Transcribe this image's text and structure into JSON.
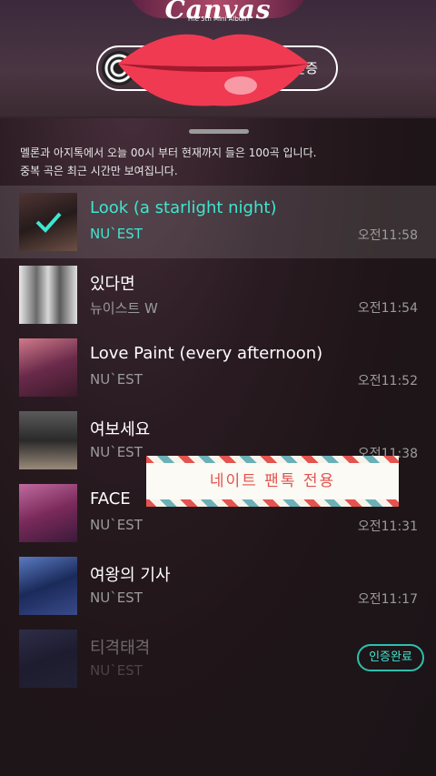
{
  "hero": {
    "album_title": "Canvas",
    "album_subtitle": "The 5th Mini Album",
    "auth_pill_label": "인증"
  },
  "notice": {
    "line1": "멜론과 아지톡에서 오늘 00시 부터 현재까지 들은 100곡 입니다.",
    "line2": "중복 곡은 최근 시간만 보여집니다."
  },
  "songs": [
    {
      "title": "Look (a starlight night)",
      "artist": "NU`EST",
      "time": "오전11:58",
      "state": "selected",
      "art_colors": [
        "#5a3a3a",
        "#a87a6a"
      ]
    },
    {
      "title": "있다면",
      "artist": "뉴이스트 W",
      "time": "오전11:54",
      "state": "normal",
      "art_colors": [
        "#d8d8d8",
        "#8a8a8a"
      ]
    },
    {
      "title": "Love Paint (every afternoon)",
      "artist": "NU`EST",
      "time": "오전11:52",
      "state": "normal",
      "art_colors": [
        "#6a2a4a",
        "#d07a8a"
      ]
    },
    {
      "title": "여보세요",
      "artist": "NU`EST",
      "time": "오전11:38",
      "state": "normal",
      "art_colors": [
        "#3a3a3a",
        "#9a8a7a"
      ]
    },
    {
      "title": "FACE",
      "artist": "NU`EST",
      "time": "오전11:31",
      "state": "normal",
      "art_colors": [
        "#7a2a5a",
        "#c06aa0"
      ]
    },
    {
      "title": "여왕의 기사",
      "artist": "NU`EST",
      "time": "오전11:17",
      "state": "normal",
      "art_colors": [
        "#1a2a5a",
        "#5a7ac0"
      ]
    },
    {
      "title": "티격태격",
      "artist": "NU`EST",
      "time": "",
      "state": "verified",
      "art_colors": [
        "#1a2a5a",
        "#4a5aa0"
      ]
    }
  ],
  "verified_label": "인증완료",
  "banner_text": "네이트 팬톡 전용",
  "colors": {
    "accent": "#3ee6d0",
    "banner_text": "#e3524b"
  }
}
